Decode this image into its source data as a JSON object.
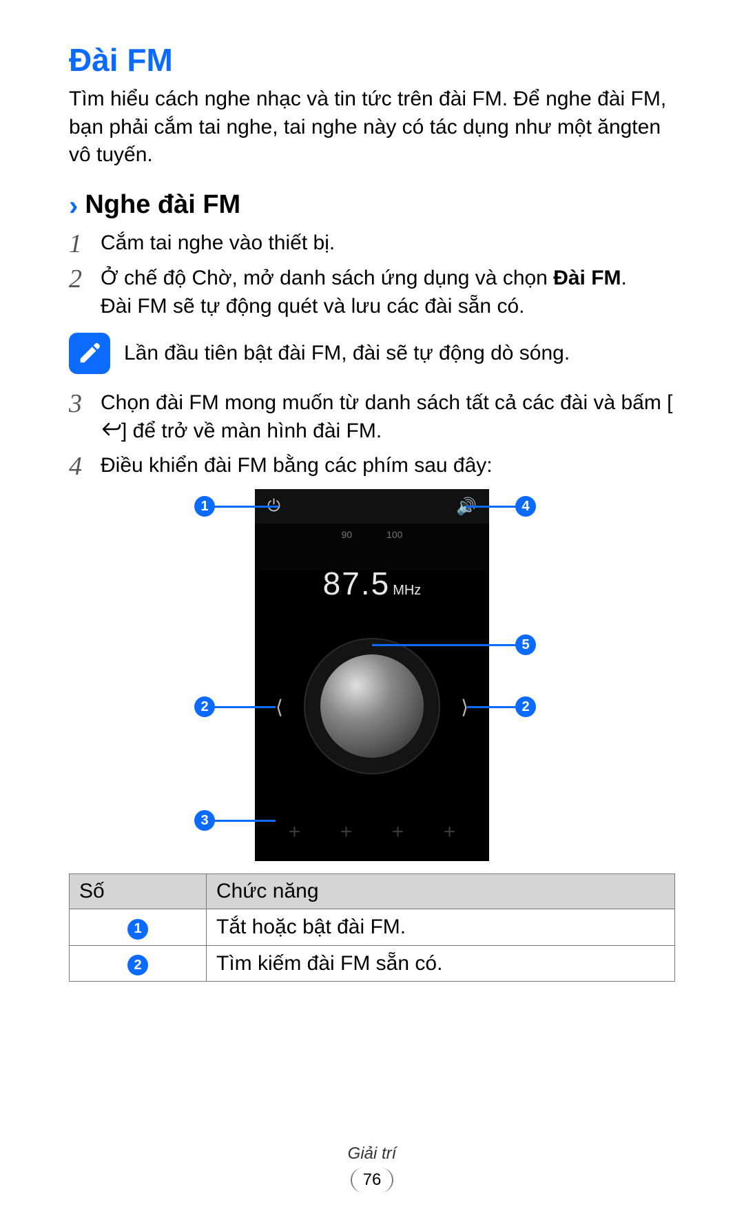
{
  "heading": "Đài FM",
  "intro": "Tìm hiểu cách nghe nhạc và tin tức trên đài FM. Để nghe đài FM, bạn phải cắm tai nghe, tai nghe này có tác dụng như một ăngten vô tuyến.",
  "sub_heading": "Nghe đài FM",
  "steps": {
    "s1": {
      "num": "1",
      "text": "Cắm tai nghe vào thiết bị."
    },
    "s2": {
      "num": "2",
      "line1_pre": "Ở chế độ Chờ, mở danh sách ứng dụng và chọn ",
      "line1_bold": "Đài FM",
      "line1_post": ".",
      "line2": "Đài FM sẽ tự động quét và lưu các đài sẵn có."
    },
    "s3": {
      "num": "3",
      "pre": "Chọn đài FM mong muốn từ danh sách tất cả các đài và bấm [",
      "post": "] để trở về màn hình đài FM."
    },
    "s4": {
      "num": "4",
      "text": "Điều khiển đài FM bằng các phím sau đây:"
    }
  },
  "note": "Lần đầu tiên bật đài FM, đài sẽ tự động dò sóng.",
  "radio": {
    "scale_left": "90",
    "scale_right": "100",
    "freq_value": "87.5",
    "freq_unit": "MHz"
  },
  "callouts": {
    "c1": "1",
    "c2": "2",
    "c3": "3",
    "c4": "4",
    "c5": "5"
  },
  "table": {
    "header_num": "Số",
    "header_func": "Chức năng",
    "rows": [
      {
        "num": "1",
        "func": "Tắt hoặc bật đài FM."
      },
      {
        "num": "2",
        "func": "Tìm kiếm đài FM sẵn có."
      }
    ]
  },
  "footer": {
    "category": "Giải trí",
    "page": "76"
  }
}
